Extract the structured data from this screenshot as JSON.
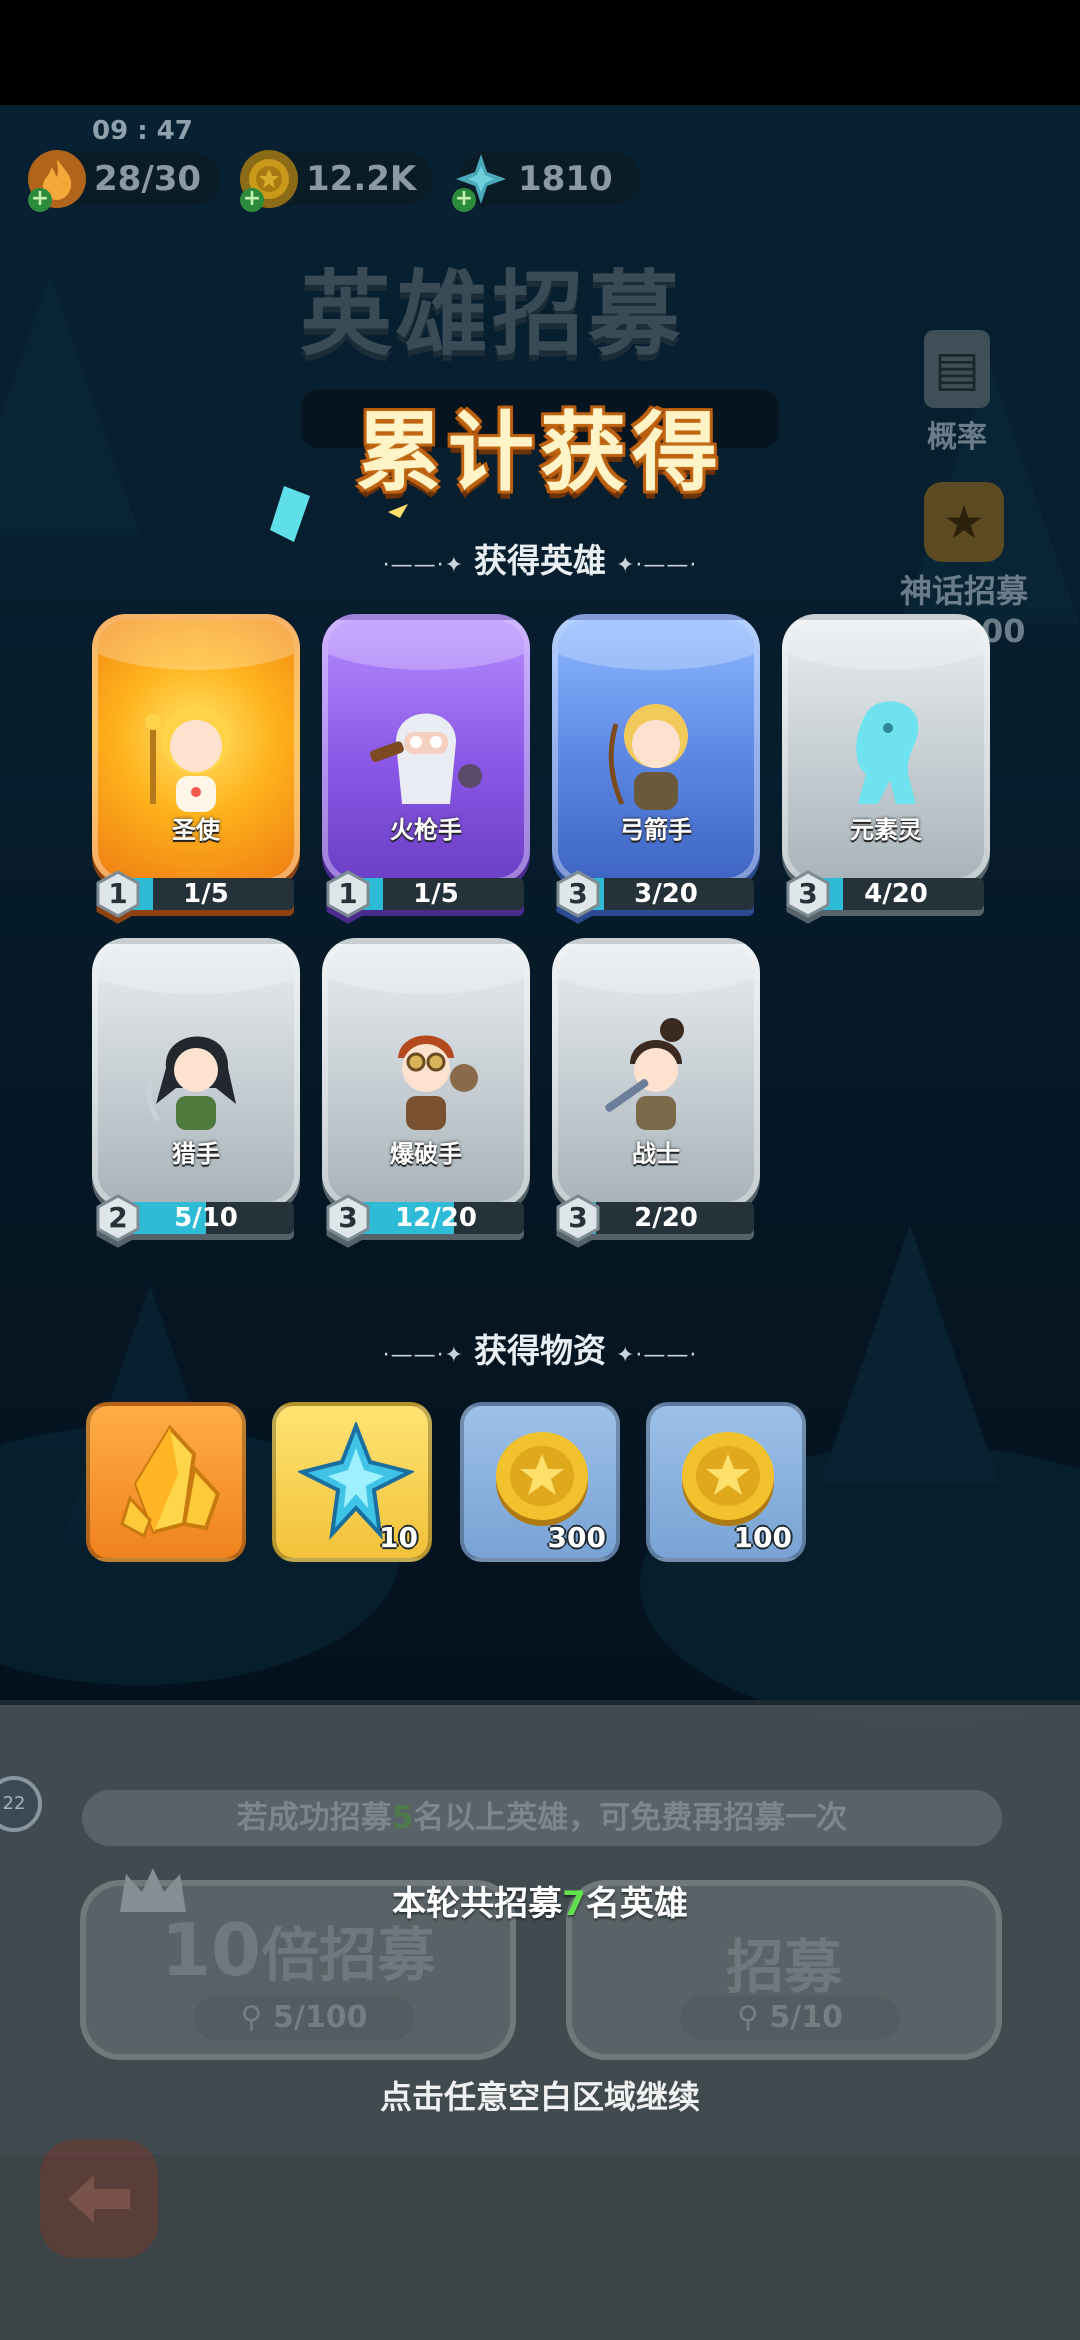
{
  "status": {
    "time": "09 : 47"
  },
  "currencies": [
    {
      "name": "stamina",
      "value": "28/30",
      "icon": "flame-icon",
      "color": "#f0a21d"
    },
    {
      "name": "gold",
      "value": "12.2K",
      "icon": "coin-icon",
      "color": "#c99a19"
    },
    {
      "name": "diamond",
      "value": "1810",
      "icon": "snowflake-crystal-icon",
      "color": "#5fd6e8"
    }
  ],
  "background": {
    "title": "英雄招募",
    "probability_label": "概率",
    "mythic_label": "神话招募",
    "mythic_progress": "0/2000"
  },
  "heading": "累计获得",
  "sections": {
    "heroes": "获得英雄",
    "items": "获得物资",
    "deco_left": "·——·✦",
    "deco_right": "✦·——·"
  },
  "heroes": [
    {
      "name": "圣使",
      "rarity": "gold",
      "level": "1",
      "progress": "1/5",
      "ratio": 0.2
    },
    {
      "name": "火枪手",
      "rarity": "purple",
      "level": "1",
      "progress": "1/5",
      "ratio": 0.2
    },
    {
      "name": "弓箭手",
      "rarity": "blue",
      "level": "3",
      "progress": "3/20",
      "ratio": 0.15
    },
    {
      "name": "元素灵",
      "rarity": "gray",
      "level": "3",
      "progress": "4/20",
      "ratio": 0.2
    },
    {
      "name": "猎手",
      "rarity": "gray",
      "level": "2",
      "progress": "5/10",
      "ratio": 0.5
    },
    {
      "name": "爆破手",
      "rarity": "gray",
      "level": "3",
      "progress": "12/20",
      "ratio": 0.6
    },
    {
      "name": "战士",
      "rarity": "gray",
      "level": "3",
      "progress": "2/20",
      "ratio": 0.1
    }
  ],
  "items": [
    {
      "icon": "gold-crystal-icon",
      "count": "",
      "bg": "orange"
    },
    {
      "icon": "snowflake-crystal-icon",
      "count": "10",
      "bg": "yellow"
    },
    {
      "icon": "coin-icon",
      "count": "300",
      "bg": "blue"
    },
    {
      "icon": "coin-icon",
      "count": "100",
      "bg": "blue"
    }
  ],
  "bottom": {
    "hint_pre": "若成功招募",
    "hint_num": "5",
    "hint_post": "名以上英雄，可免费再招募一次",
    "btn10_num": "10",
    "btn10_text": "倍招募",
    "btn10_cost": "5/100",
    "btn1_text": "招募",
    "btn1_cost": "5/10",
    "summary_pre": "本轮共招募",
    "summary_num": "7",
    "summary_post": "名英雄",
    "continue": "点击任意空白区域继续",
    "left_badge": "22"
  }
}
